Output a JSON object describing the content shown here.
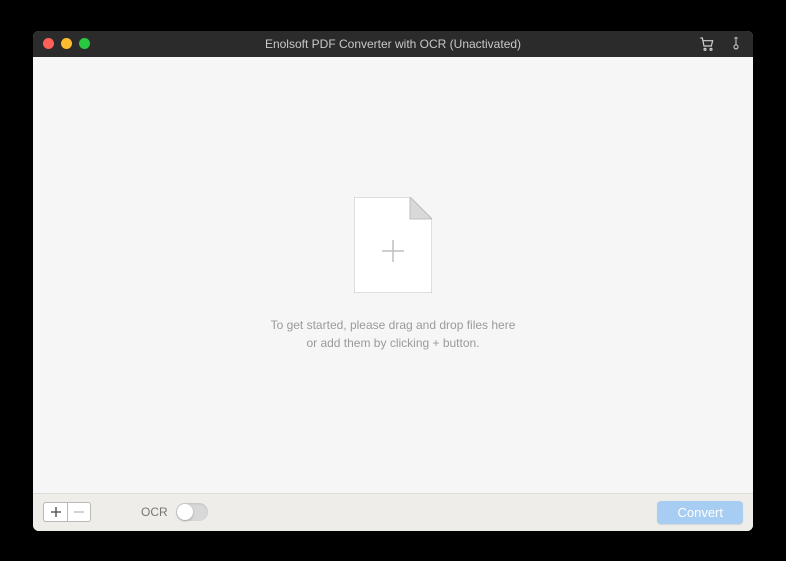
{
  "titlebar": {
    "title": "Enolsoft PDF Converter with OCR (Unactivated)"
  },
  "main": {
    "drop_line1": "To get started, please drag and drop files here",
    "drop_line2": "or add them by clicking + button."
  },
  "bottombar": {
    "ocr_label": "OCR",
    "convert_label": "Convert"
  }
}
